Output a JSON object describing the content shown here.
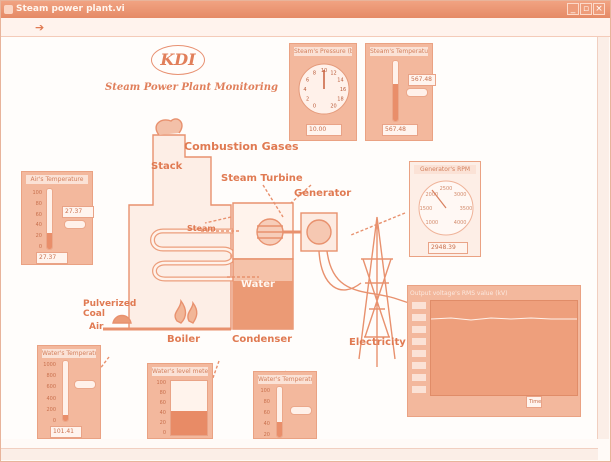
{
  "window": {
    "title": "Steam power plant.vi",
    "buttons": {
      "minimize": "_",
      "maximize": "▫",
      "close": "×"
    }
  },
  "toolbar": {
    "run_arrow": "➔"
  },
  "logo": "KDI",
  "app_title": "Steam Power Plant Monitoring",
  "diagram": {
    "stack": "Stack",
    "combustion_gases": "Combustion Gases",
    "steam_turbine": "Steam Turbine",
    "generator": "Generator",
    "steam": "Steam",
    "water": "Water",
    "pulverized_coal": "Pulverized\nCoal",
    "air": "Air",
    "boiler": "Boiler",
    "condenser": "Condenser",
    "electricity": "Electricity"
  },
  "panels": {
    "steam_pressure": {
      "title": "Steam's Pressure (bar)",
      "ticks": [
        "0",
        "2",
        "4",
        "6",
        "8",
        "10",
        "12",
        "14",
        "16",
        "18",
        "20"
      ],
      "value": "10.00",
      "needle": 10,
      "max": 20
    },
    "steam_temp": {
      "title": "Steam's Temperature",
      "value": "567.48",
      "readout": "567.48",
      "fraction": 0.62
    },
    "air_temp": {
      "title": "Air's Temperature",
      "ticks": [
        "100",
        "80",
        "60",
        "40",
        "20",
        "0"
      ],
      "value": "27.37",
      "readout": "27.37",
      "fraction": 0.27
    },
    "generator_rpm": {
      "title": "Generator's RPM",
      "ticks": [
        "1000",
        "1500",
        "2000",
        "2500",
        "3000",
        "3500",
        "4000"
      ],
      "value": "2948.39"
    },
    "voltage": {
      "title": "Output voltage's RMS value (kV)",
      "x_label": "Time"
    },
    "water_temp1": {
      "title": "Water's Temperature",
      "ticks": [
        "1000",
        "800",
        "600",
        "400",
        "200",
        "0"
      ],
      "value": "101.41",
      "fraction": 0.1
    },
    "water_level": {
      "title": "Water's level meter",
      "ticks": [
        "100",
        "80",
        "60",
        "40",
        "20",
        "0"
      ],
      "fraction": 0.45
    },
    "water_temp2": {
      "title": "Water's Temperature",
      "ticks": [
        "100",
        "80",
        "60",
        "40",
        "20"
      ],
      "fraction": 0.3
    }
  }
}
